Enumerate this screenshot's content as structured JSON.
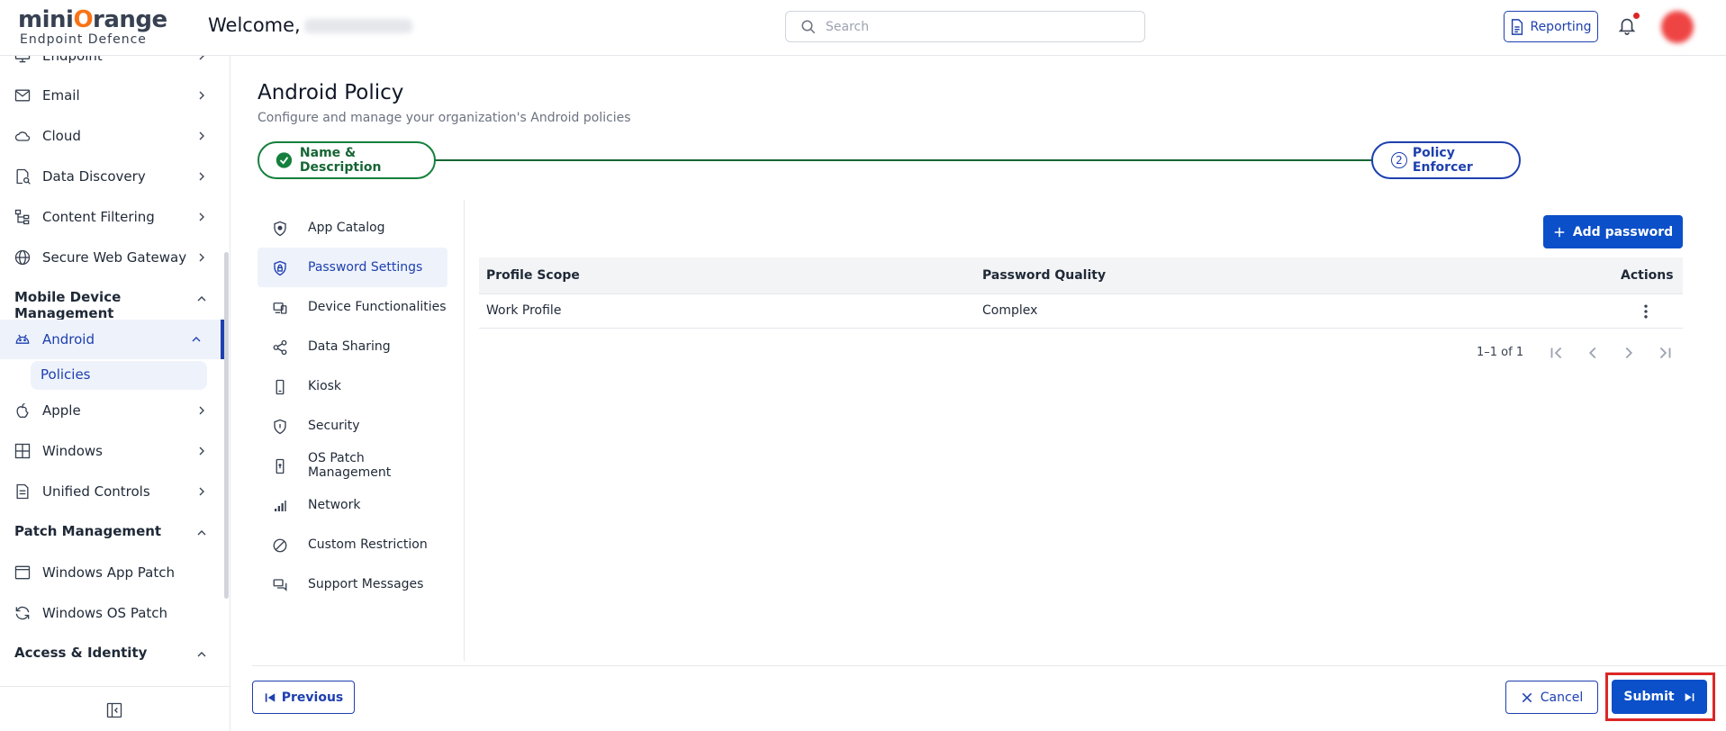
{
  "header": {
    "logo_brand_a": "mini",
    "logo_brand_o": "O",
    "logo_brand_b": "range",
    "logo_sub": "Endpoint Defence",
    "welcome": "Welcome,",
    "search_placeholder": "Search",
    "reporting_label": "Reporting"
  },
  "sidebar": {
    "items": [
      {
        "label": "Endpoint"
      },
      {
        "label": "Email"
      },
      {
        "label": "Cloud"
      },
      {
        "label": "Data Discovery"
      },
      {
        "label": "Content Filtering"
      },
      {
        "label": "Secure Web Gateway"
      }
    ],
    "section_mdm": "Mobile Device Management",
    "android": "Android",
    "policies": "Policies",
    "apple": "Apple",
    "windows": "Windows",
    "unified_controls": "Unified Controls",
    "section_patch": "Patch Management",
    "windows_app_patch": "Windows App Patch",
    "windows_os_patch": "Windows OS Patch",
    "section_access": "Access & Identity"
  },
  "page": {
    "title": "Android Policy",
    "subtitle": "Configure and manage your organization's Android policies"
  },
  "stepper": {
    "step1": "Name & Description",
    "step2_num": "2",
    "step2": "Policy Enforcer"
  },
  "policy_nav": [
    {
      "label": "App Catalog"
    },
    {
      "label": "Password Settings"
    },
    {
      "label": "Device Functionalities"
    },
    {
      "label": "Data Sharing"
    },
    {
      "label": "Kiosk"
    },
    {
      "label": "Security"
    },
    {
      "label": "OS Patch Management"
    },
    {
      "label": "Network"
    },
    {
      "label": "Custom Restriction"
    },
    {
      "label": "Support Messages"
    }
  ],
  "table": {
    "add_label": "Add password",
    "headers": {
      "scope": "Profile Scope",
      "quality": "Password Quality",
      "actions": "Actions"
    },
    "rows": [
      {
        "scope": "Work Profile",
        "quality": "Complex"
      }
    ],
    "pagination": "1–1 of 1"
  },
  "footer": {
    "previous": "Previous",
    "cancel": "Cancel",
    "submit": "Submit"
  },
  "colors": {
    "accent": "#1e40af",
    "primary_button": "#0b4fc9",
    "success": "#15803d",
    "highlight": "#dc2626"
  }
}
